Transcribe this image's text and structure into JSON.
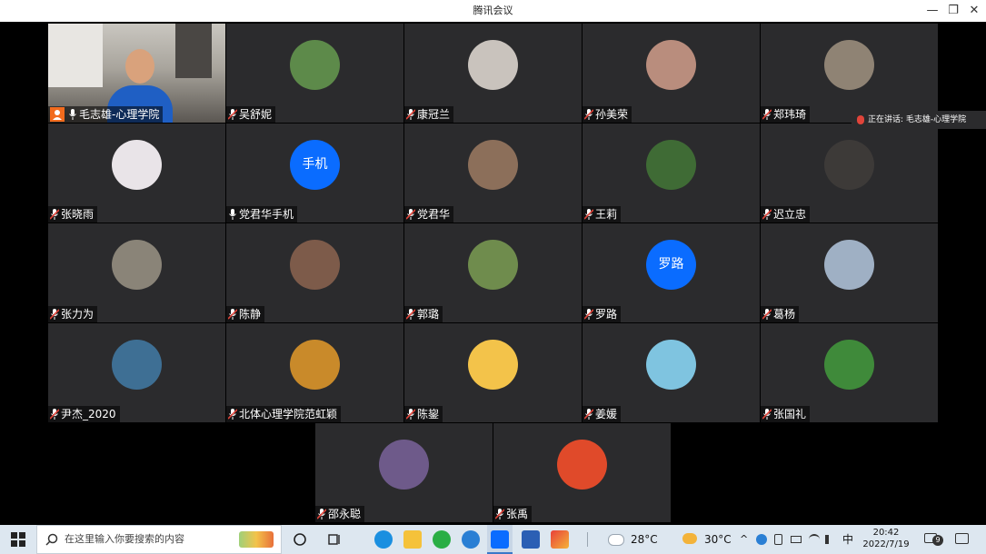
{
  "window": {
    "title": "腾讯会议",
    "minimize": "—",
    "restore": "❐",
    "close": "✕"
  },
  "speaking_indicator": "正在讲话: 毛志雄-心理学院",
  "participants": [
    {
      "name": "毛志雄-心理学院",
      "mic": "on",
      "host": true,
      "video": true
    },
    {
      "name": "吴舒妮",
      "mic": "muted",
      "avatar_color": "#5d8a4a"
    },
    {
      "name": "康冠兰",
      "mic": "muted",
      "avatar_color": "#c9c3bd"
    },
    {
      "name": "孙美荣",
      "mic": "muted",
      "avatar_color": "#b98d7d"
    },
    {
      "name": "郑玮琦",
      "mic": "muted",
      "avatar_color": "#8f8374"
    },
    {
      "name": "张晓雨",
      "mic": "muted",
      "avatar_color": "#e9e4e8"
    },
    {
      "name": "党君华手机",
      "mic": "on",
      "avatar_text": "手机"
    },
    {
      "name": "党君华",
      "mic": "muted",
      "avatar_color": "#8c6f5a"
    },
    {
      "name": "王莉",
      "mic": "muted",
      "avatar_color": "#3f6b35"
    },
    {
      "name": "迟立忠",
      "mic": "muted",
      "avatar_color": "#3d3a38"
    },
    {
      "name": "张力为",
      "mic": "muted",
      "avatar_color": "#8a8478"
    },
    {
      "name": "陈静",
      "mic": "muted",
      "avatar_color": "#7d5b4a"
    },
    {
      "name": "郭璐",
      "mic": "muted",
      "avatar_color": "#6f8c4d"
    },
    {
      "name": "罗路",
      "mic": "muted",
      "avatar_text": "罗路"
    },
    {
      "name": "葛杨",
      "mic": "muted",
      "avatar_color": "#9fb0c4"
    },
    {
      "name": "尹杰_2020",
      "mic": "muted",
      "avatar_color": "#3e6f94"
    },
    {
      "name": "北体心理学院范虹颖",
      "mic": "muted",
      "avatar_color": "#c98a2a"
    },
    {
      "name": "陈鋆",
      "mic": "muted",
      "avatar_color": "#f3c34a"
    },
    {
      "name": "姜媛",
      "mic": "muted",
      "avatar_color": "#7fc4e0"
    },
    {
      "name": "张国礼",
      "mic": "muted",
      "avatar_color": "#3f8a3a"
    },
    {
      "name": "邵永聪",
      "mic": "muted",
      "avatar_color": "#6e5a8a"
    },
    {
      "name": "张禹",
      "mic": "muted",
      "avatar_color": "#e04a2a"
    }
  ],
  "taskbar": {
    "search_placeholder": "在这里输入你要搜索的内容",
    "weather1": "28°C",
    "weather2": "30°C",
    "ime": "中",
    "time": "20:42",
    "date": "2022/7/19",
    "notification_count": "9"
  },
  "colors": {
    "tile_bg": "#2b2b2d",
    "avatar_blue": "#0a6cff",
    "host_badge": "#f26b1d",
    "mic_muted": "#e0443a",
    "taskbar_bg": "#dde7f0"
  }
}
